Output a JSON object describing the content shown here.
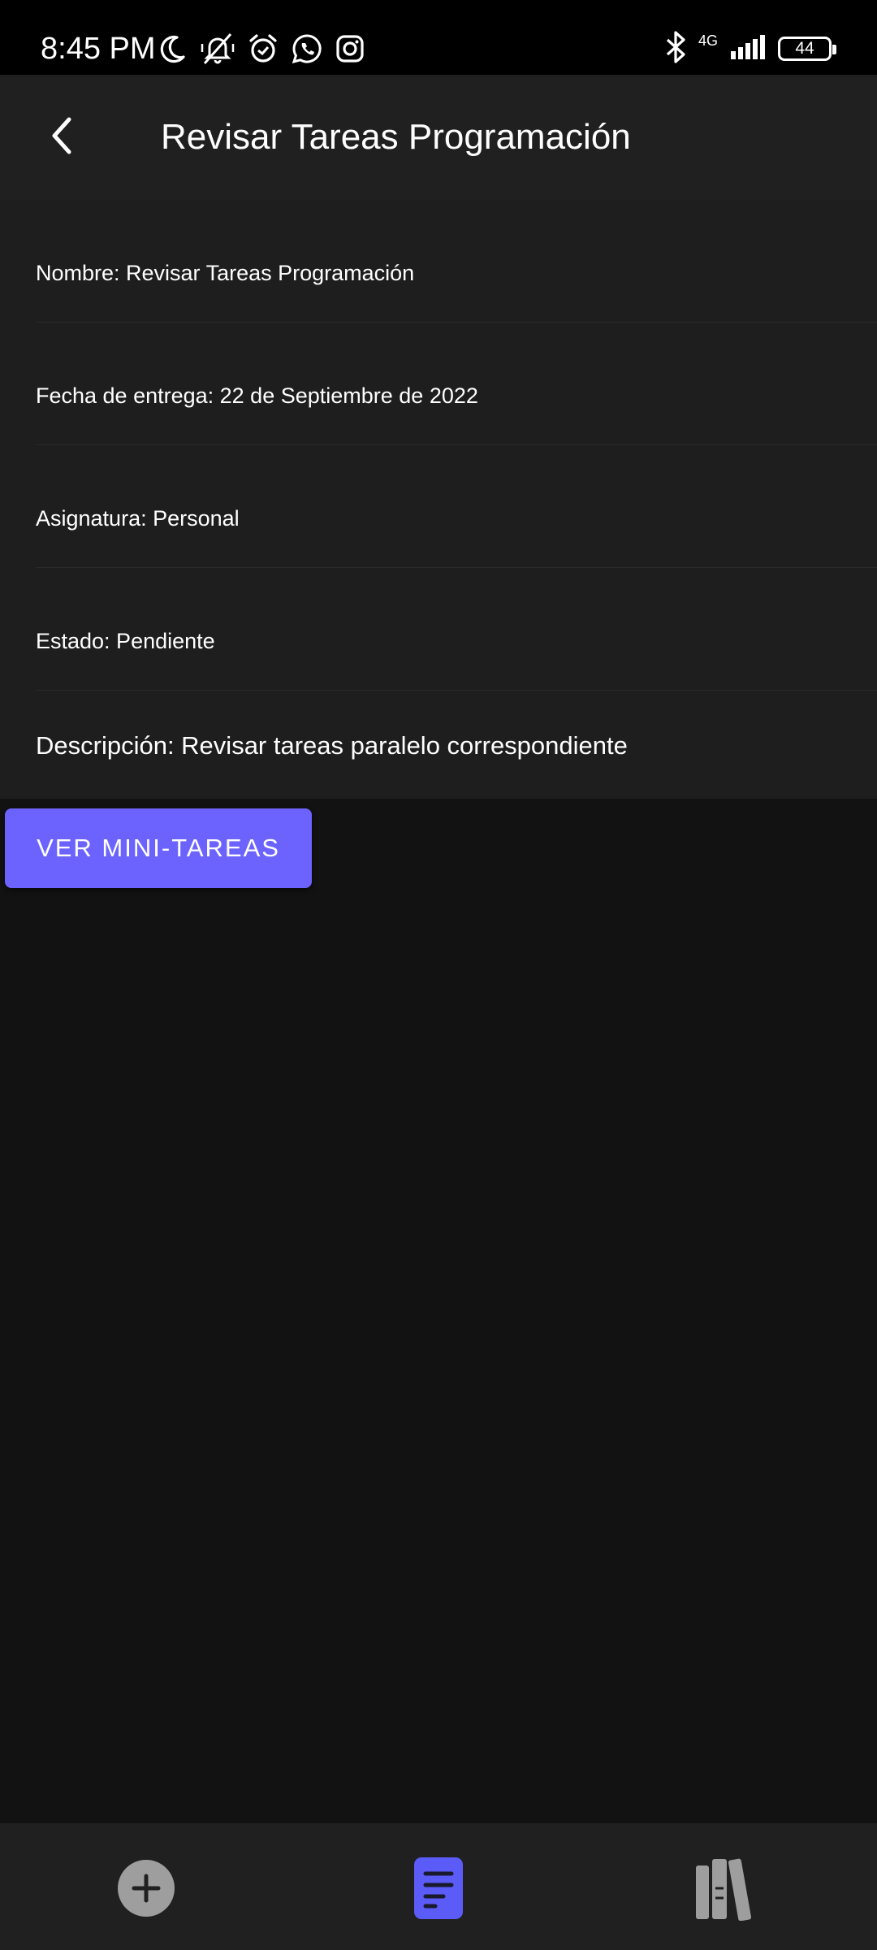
{
  "status_bar": {
    "time": "8:45 PM",
    "network_type": "4G",
    "battery_level": "44",
    "left_icons": [
      "moon-icon",
      "bell-off-icon",
      "alarm-icon",
      "whatsapp-icon",
      "instagram-icon"
    ],
    "right_icons": [
      "bluetooth-icon",
      "signal-icon",
      "battery-icon"
    ]
  },
  "app_bar": {
    "title": "Revisar Tareas Programación",
    "back_icon": "chevron-left-icon"
  },
  "details": {
    "name": "Nombre: Revisar Tareas Programación",
    "due_date": "Fecha de entrega: 22 de Septiembre de 2022",
    "subject": "Asignatura: Personal",
    "status": "Estado: Pendiente",
    "description": "Descripción: Revisar tareas paralelo correspondiente"
  },
  "actions": {
    "mini_tasks_label": "VER MINI-TAREAS"
  },
  "bottom_nav": {
    "items": [
      {
        "icon": "add-circle-icon",
        "active": false
      },
      {
        "icon": "document-icon",
        "active": true
      },
      {
        "icon": "library-icon",
        "active": false
      }
    ]
  },
  "colors": {
    "accent": "#6c63ff",
    "active_nav": "#5b5bf7",
    "inactive_nav": "#9e9e9e",
    "background": "#121212",
    "surface": "#1e1e1e"
  }
}
